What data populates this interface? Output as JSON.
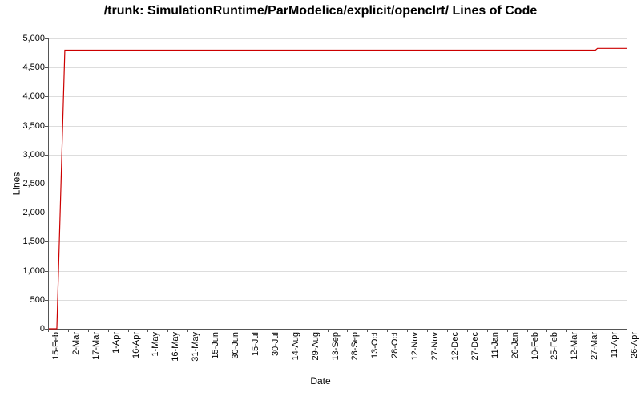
{
  "chart_data": {
    "type": "line",
    "title": "/trunk: SimulationRuntime/ParModelica/explicit/openclrt/ Lines of Code",
    "xlabel": "Date",
    "ylabel": "Lines",
    "ylim": [
      0,
      5000
    ],
    "y_ticks": [
      0,
      500,
      1000,
      1500,
      2000,
      2500,
      3000,
      3500,
      4000,
      4500,
      5000
    ],
    "y_tick_labels": [
      "0",
      "500",
      "1,000",
      "1,500",
      "2,000",
      "2,500",
      "3,000",
      "3,500",
      "4,000",
      "4,500",
      "5,000"
    ],
    "x_tick_labels": [
      "15-Feb",
      "2-Mar",
      "17-Mar",
      "1-Apr",
      "16-Apr",
      "1-May",
      "16-May",
      "31-May",
      "15-Jun",
      "30-Jun",
      "15-Jul",
      "30-Jul",
      "14-Aug",
      "29-Aug",
      "13-Sep",
      "28-Sep",
      "13-Oct",
      "28-Oct",
      "12-Nov",
      "27-Nov",
      "12-Dec",
      "27-Dec",
      "11-Jan",
      "26-Jan",
      "10-Feb",
      "25-Feb",
      "12-Mar",
      "27-Mar",
      "11-Apr",
      "26-Apr"
    ],
    "series": [
      {
        "name": "Lines of Code",
        "color": "#cc0000",
        "x_index": [
          0,
          0.4,
          0.8,
          1,
          2,
          3,
          4,
          5,
          6,
          7,
          8,
          9,
          10,
          11,
          12,
          13,
          14,
          15,
          16,
          17,
          18,
          19,
          20,
          21,
          22,
          23,
          24,
          25,
          26,
          27,
          27.4,
          27.5,
          28,
          29
        ],
        "y": [
          0,
          0,
          4800,
          4800,
          4800,
          4800,
          4800,
          4800,
          4800,
          4800,
          4800,
          4800,
          4800,
          4800,
          4800,
          4800,
          4800,
          4800,
          4800,
          4800,
          4800,
          4800,
          4800,
          4800,
          4800,
          4800,
          4800,
          4800,
          4800,
          4800,
          4800,
          4830,
          4830,
          4830
        ]
      }
    ]
  }
}
